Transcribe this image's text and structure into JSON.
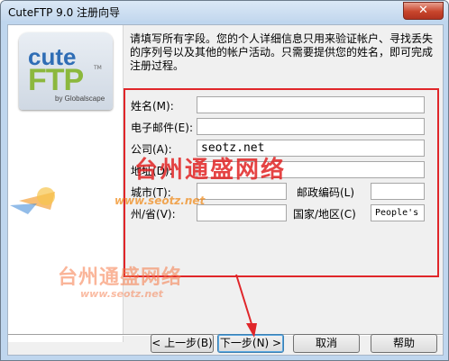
{
  "window": {
    "title": "CuteFTP 9.0 注册向导",
    "close_glyph": "✕"
  },
  "logo": {
    "line1": "cute",
    "line2": "FTP",
    "tm": "TM",
    "byline": "by Globalscape"
  },
  "intro_text": "请填写所有字段。您的个人详细信息只用来验证帐户、寻找丢失的序列号以及其他的帐户活动。只需要提供您的姓名，即可完成注册过程。",
  "form": {
    "name_label": "姓名(M):",
    "email_label": "电子邮件(E):",
    "company_label": "公司(A):",
    "company_value": "seotz.net",
    "address_label": "地址(D):",
    "city_label": "城市(T):",
    "zip_label": "邮政编码(L)",
    "state_label": "州/省(V):",
    "country_label": "国家/地区(C)",
    "country_value": "People's R"
  },
  "watermark": {
    "main": "台州通盛网络",
    "url1": "www.seotz.net",
    "main2": "台州通盛网络",
    "url2": "www.seotz.net"
  },
  "buttons": {
    "back": "< 上一步(B)",
    "next": "下一步(N) >",
    "cancel": "取消",
    "help": "帮助"
  },
  "colors": {
    "highlight_box": "#e0262a",
    "logo_blue": "#2f6db5",
    "logo_green": "#8cb83d"
  }
}
